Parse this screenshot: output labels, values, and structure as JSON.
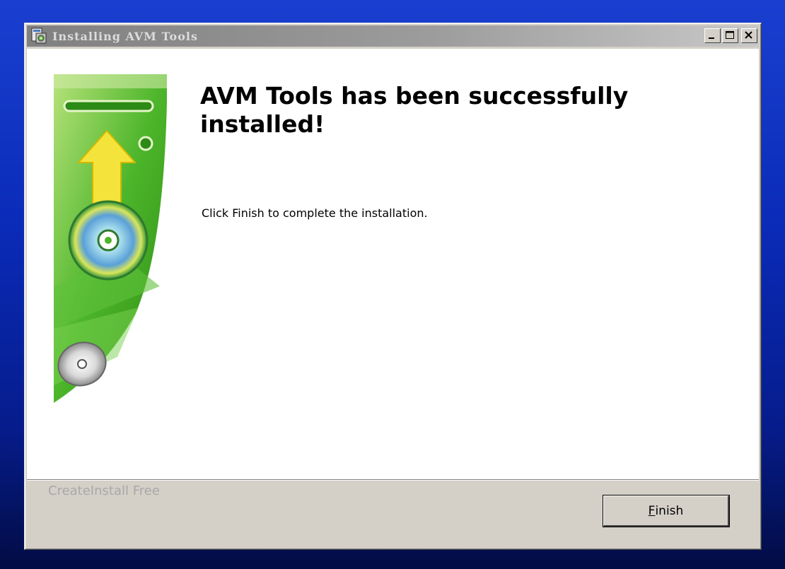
{
  "window": {
    "title": "Installing AVM Tools",
    "controls": {
      "minimize": "minimize",
      "maximize": "maximize",
      "close": "close"
    }
  },
  "content": {
    "heading": "AVM Tools has been successfully installed!",
    "message": "Click Finish to complete the installation."
  },
  "footer": {
    "brand": "CreateInstall Free",
    "finish_mnemonic": "F",
    "finish_rest": "inish"
  },
  "colors": {
    "desktop": "#0a2bb8",
    "titlebar": "#808080",
    "dialog": "#d4d0c8",
    "art_green": "#3fae1f"
  },
  "icons": [
    "installer-app-icon",
    "minimize-icon",
    "maximize-icon",
    "close-icon",
    "installer-sidebar-graphic"
  ]
}
